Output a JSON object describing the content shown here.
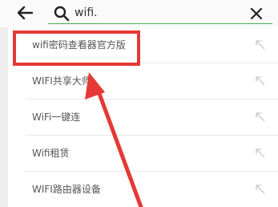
{
  "search": {
    "query": "wifi."
  },
  "suggestions": [
    {
      "label": "wifi密码查看器官方版"
    },
    {
      "label": "WIFI共享大师"
    },
    {
      "label": "WiFi一键连"
    },
    {
      "label": "Wifi租赁"
    },
    {
      "label": "WIFI路由器设备"
    }
  ],
  "icons": {
    "back": "arrow-left-icon",
    "search": "search-icon",
    "clear": "close-icon",
    "fill": "arrow-up-left-icon"
  },
  "colors": {
    "highlight": "#e53935",
    "search_underline": "#4caf50",
    "text": "#555555"
  }
}
